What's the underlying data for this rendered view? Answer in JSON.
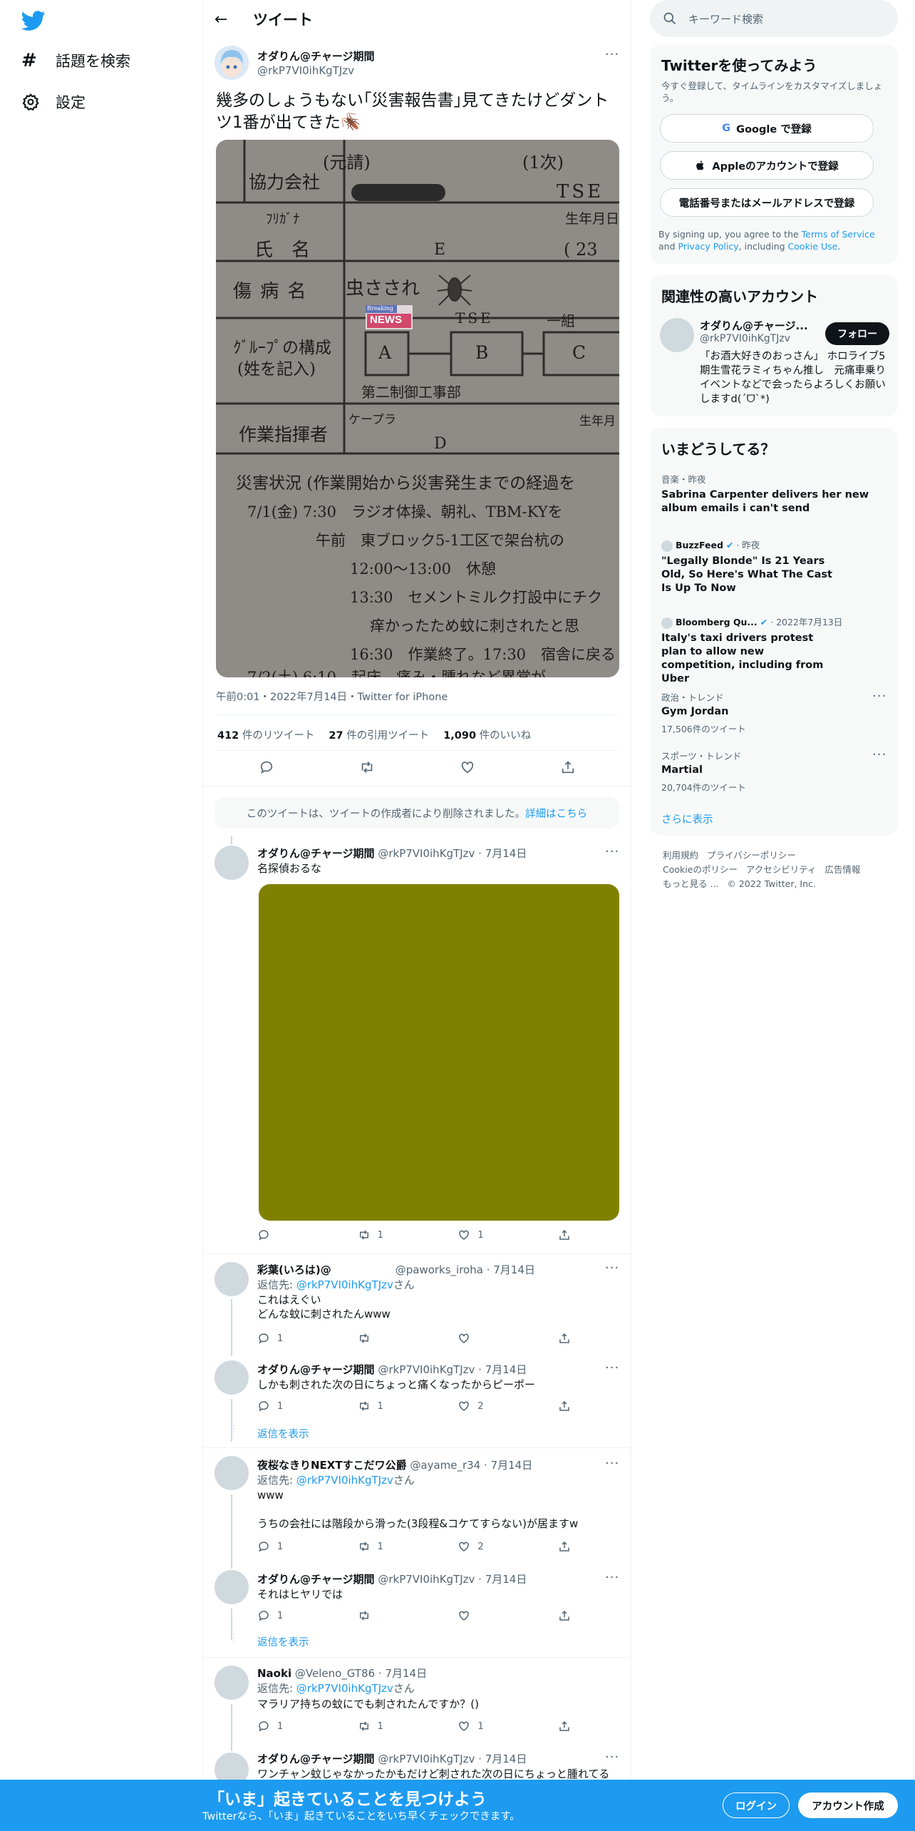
{
  "nav": {
    "explore_label": "話題を検索",
    "settings_label": "設定"
  },
  "header": {
    "title": "ツイート"
  },
  "main_tweet": {
    "name": "オダりん@チャージ期間",
    "handle": "@rkP7VI0ihKgTJzv",
    "text": "幾多のしょうもない｢災害報告書｣見てきたけどダントツ1番が出てきた🪳",
    "photo_text": {
      "r1a": "協力会社",
      "r1b": "(元請)",
      "r1c": "(1次)",
      "r1d": "TSE",
      "furigana": "ﾌﾘｶﾞﾅ",
      "birth": "生年月日",
      "shimei": "氏　名",
      "e": "E",
      "age": "( 23",
      "injury_label": "傷 病 名",
      "injury_value": "虫さされ",
      "breaking": "Breaking",
      "news": "NEWS",
      "tse": "TSE",
      "ichikumi": "一組",
      "group_label": "ｸﾞﾙｰﾌﾟの構成",
      "group_sub": "(姓を記入)",
      "a": "A",
      "b": "B",
      "c": "C",
      "dept": "第二制御工事部",
      "keipura": "ケープラ",
      "birth2": "生年月",
      "leader": "作業指揮者",
      "d": "D",
      "situation": "災害状況 (作業開始から災害発生までの経過を",
      "l1": "7/1(金) 7:30　ラジオ体操、朝礼、TBM-KYを",
      "l2": "午前　東ブロック5-1工区で架台杭の",
      "l3": "12:00〜13:00　休憩",
      "l4": "13:30　セメントミルク打設中にチク",
      "l5": "痒かったため蚊に刺されたと思",
      "l6": "16:30　作業終了。17:30　宿舎に戻る",
      "l7": "7/2(土) 6:10　起床、痛み・腫れなど異常が"
    },
    "meta": "午前0:01・2022年7月14日・Twitter for iPhone",
    "retweets": "412",
    "retweets_label": "件のリツイート",
    "quotes": "27",
    "quotes_label": "件の引用ツイート",
    "likes": "1,090",
    "likes_label": "件のいいね"
  },
  "deleted_notice": {
    "text": "このツイートは、ツイートの作成者により削除されました。",
    "link": "詳細はこちら"
  },
  "replies": [
    {
      "name": "オダりん@チャージ期間",
      "handle": "@rkP7VI0ihKgTJzv",
      "date": "7月14日",
      "text": "名探偵おるな",
      "retweets": "1",
      "likes": "1"
    },
    {
      "name": "彩葉(いろは)@",
      "handle": "@paworks_iroha",
      "date": "7月14日",
      "reply_to_label": "返信先: ",
      "reply_to": "@rkP7VI0ihKgTJzv",
      "reply_suffix": "さん",
      "text": "これはえぐい\nどんな蚊に刺されたんwww",
      "replies": "1"
    },
    {
      "name": "オダりん@チャージ期間",
      "handle": "@rkP7VI0ihKgTJzv",
      "date": "7月14日",
      "text": "しかも刺された次の日にちょっと痛くなったからピーポー",
      "replies": "1",
      "retweets": "1",
      "likes": "2",
      "show_replies": "返信を表示"
    },
    {
      "name": "夜桜なきりNEXTすこだワ公爵",
      "handle": "@ayame_r34",
      "date": "7月14日",
      "reply_to_label": "返信先: ",
      "reply_to": "@rkP7VI0ihKgTJzv",
      "reply_suffix": "さん",
      "text": "www\n\nうちの会社には階段から滑った(3段程&コケてすらない)が居ますw",
      "replies": "1",
      "retweets": "1",
      "likes": "2"
    },
    {
      "name": "オダりん@チャージ期間",
      "handle": "@rkP7VI0ihKgTJzv",
      "date": "7月14日",
      "text": "それはヒヤリでは",
      "replies": "1",
      "show_replies": "返信を表示"
    },
    {
      "name": "Naoki",
      "handle": "@Veleno_GT86",
      "date": "7月14日",
      "reply_to_label": "返信先: ",
      "reply_to": "@rkP7VI0ihKgTJzv",
      "reply_suffix": "さん",
      "text": "マラリア持ちの蚊にでも刺されたんですか？()",
      "replies": "1",
      "retweets": "1",
      "likes": "1"
    },
    {
      "name": "オダりん@チャージ期間",
      "handle": "@rkP7VI0ihKgTJzv",
      "date": "7月14日",
      "text": "ワンチャン蚊じゃなかったかもだけど刺された次の日にちょっと腫れてる"
    }
  ],
  "sidebar": {
    "search_placeholder": "キーワード検索",
    "signup_title": "Twitterを使ってみよう",
    "signup_sub": "今すぐ登録して、タイムラインをカスタマイズしましょう。",
    "google_btn": "Google で登録",
    "apple_btn": "Appleのアカウントで登録",
    "phone_btn": "電話番号またはメールアドレスで登録",
    "terms_1": "By signing up, you agree to the ",
    "terms_link": "Terms of Service",
    "terms_2": " and ",
    "privacy_link": "Privacy Policy",
    "terms_3": ", including ",
    "cookie_link": "Cookie Use",
    "terms_4": ".",
    "related_title": "関連性の高いアカウント",
    "related_name": "オダりん@チャージ...",
    "related_handle": "@rkP7VI0ihKgTJzv",
    "related_bio": "「お酒大好きのおっさん」 ホロライブ5期生雪花ラミィちゃん推し　元痛車乗りイベントなどで会ったらよろしくお願いしますd(ˊᗜˋ*)",
    "follow_btn": "フォロー",
    "trends_title": "いまどうしてる？",
    "trends": [
      {
        "category": "音楽・昨夜",
        "title": "Sabrina Carpenter delivers her new album emails i can't send"
      },
      {
        "source": "BuzzFeed",
        "category": "昨夜",
        "title": "\"Legally Blonde\" Is 21 Years Old, So Here's What The Cast Is Up To Now"
      },
      {
        "source": "Bloomberg Qu...",
        "category": "2022年7月13日",
        "title": "Italy's taxi drivers protest plan to allow new competition, including from Uber"
      },
      {
        "category": "政治・トレンド",
        "title": "Gym Jordan",
        "count": "17,506件のツイート"
      },
      {
        "category": "スポーツ・トレンド",
        "title": "Martial",
        "count": "20,704件のツイート"
      }
    ],
    "show_more": "さらに表示",
    "footer": {
      "f1": "利用規約",
      "f2": "プライバシーポリシー",
      "f3": "Cookieのポリシー",
      "f4": "アクセシビリティ",
      "f5": "広告情報",
      "f6": "もっと見る ...",
      "f7": "© 2022 Twitter, Inc."
    }
  },
  "bottom_bar": {
    "title": "「いま」起きていることを見つけよう",
    "subtitle": "Twitterなら、「いま」起きていることをいち早くチェックできます。",
    "login": "ログイン",
    "signup": "アカウント作成"
  },
  "colors": {
    "accent": "#1d9bf0",
    "olive": "#808000",
    "text": "#0f1419",
    "muted": "#536471"
  }
}
